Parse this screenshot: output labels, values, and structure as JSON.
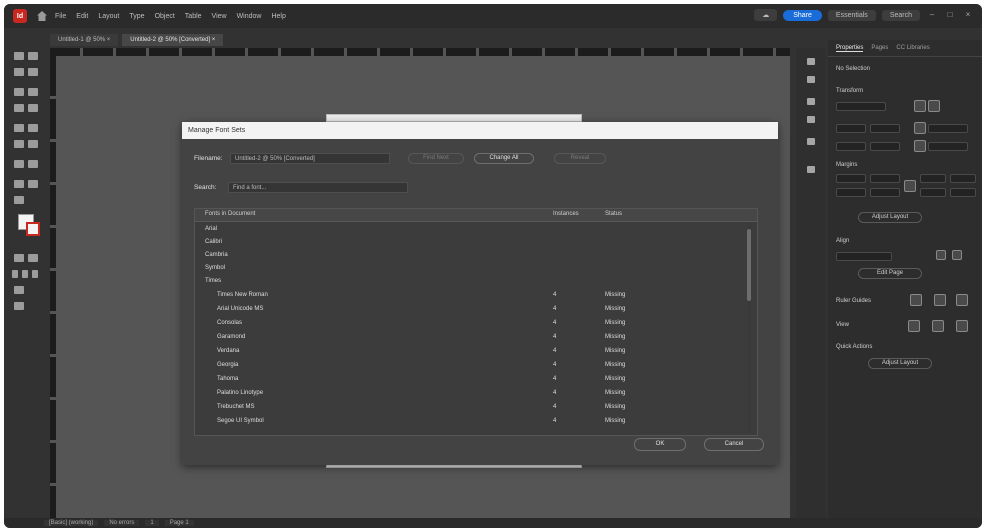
{
  "app": {
    "logo": "Id",
    "share_label": "Share",
    "workspace_label": "Essentials",
    "search_label": "Search"
  },
  "menubar": {
    "items": [
      "File",
      "Edit",
      "Layout",
      "Type",
      "Object",
      "Table",
      "View",
      "Window",
      "Help"
    ]
  },
  "document_tabs": [
    {
      "label": "Untitled-1 @ 50% ×"
    },
    {
      "label": "Untitled-2 @ 50% [Converted] ×"
    }
  ],
  "dialog": {
    "title": "Manage Font Sets",
    "filename_label": "Filename:",
    "filename_value": "Untitled-2 @ 50% [Converted]",
    "search_label": "Search:",
    "search_value": "Find a font...",
    "buttons": {
      "find": "Find Next",
      "change": "Change All",
      "reveal": "Reveal",
      "ok": "OK",
      "cancel": "Cancel"
    },
    "columns": {
      "name": "Fonts in Document",
      "qty": "Instances",
      "status": "Status"
    },
    "list_groups": [
      "Arial",
      "Calibri",
      "Cambria",
      "Symbol",
      "Times"
    ],
    "rows": [
      {
        "name": "Times New Roman",
        "qty": "4",
        "status": "Missing"
      },
      {
        "name": "Arial Unicode MS",
        "qty": "4",
        "status": "Missing"
      },
      {
        "name": "Consolas",
        "qty": "4",
        "status": "Missing"
      },
      {
        "name": "Garamond",
        "qty": "4",
        "status": "Missing"
      },
      {
        "name": "Verdana",
        "qty": "4",
        "status": "Missing"
      },
      {
        "name": "Georgia",
        "qty": "4",
        "status": "Missing"
      },
      {
        "name": "Tahoma",
        "qty": "4",
        "status": "Missing"
      },
      {
        "name": "Palatino Linotype",
        "qty": "4",
        "status": "Missing"
      },
      {
        "name": "Trebuchet MS",
        "qty": "4",
        "status": "Missing"
      },
      {
        "name": "Segoe UI Symbol",
        "qty": "4",
        "status": "Missing"
      }
    ]
  },
  "panel": {
    "tabs": [
      "Properties",
      "Pages",
      "CC Libraries"
    ],
    "section_label": "No Selection",
    "transform_label": "Transform",
    "align_label": "Align",
    "ruler_label": "Ruler Guides",
    "quick_label": "Quick Actions",
    "button_label": "Adjust Layout",
    "button_label_2": "Edit Page"
  },
  "status": {
    "items": [
      "[Basic] (working)",
      "No errors",
      "1",
      "Page 1"
    ]
  }
}
